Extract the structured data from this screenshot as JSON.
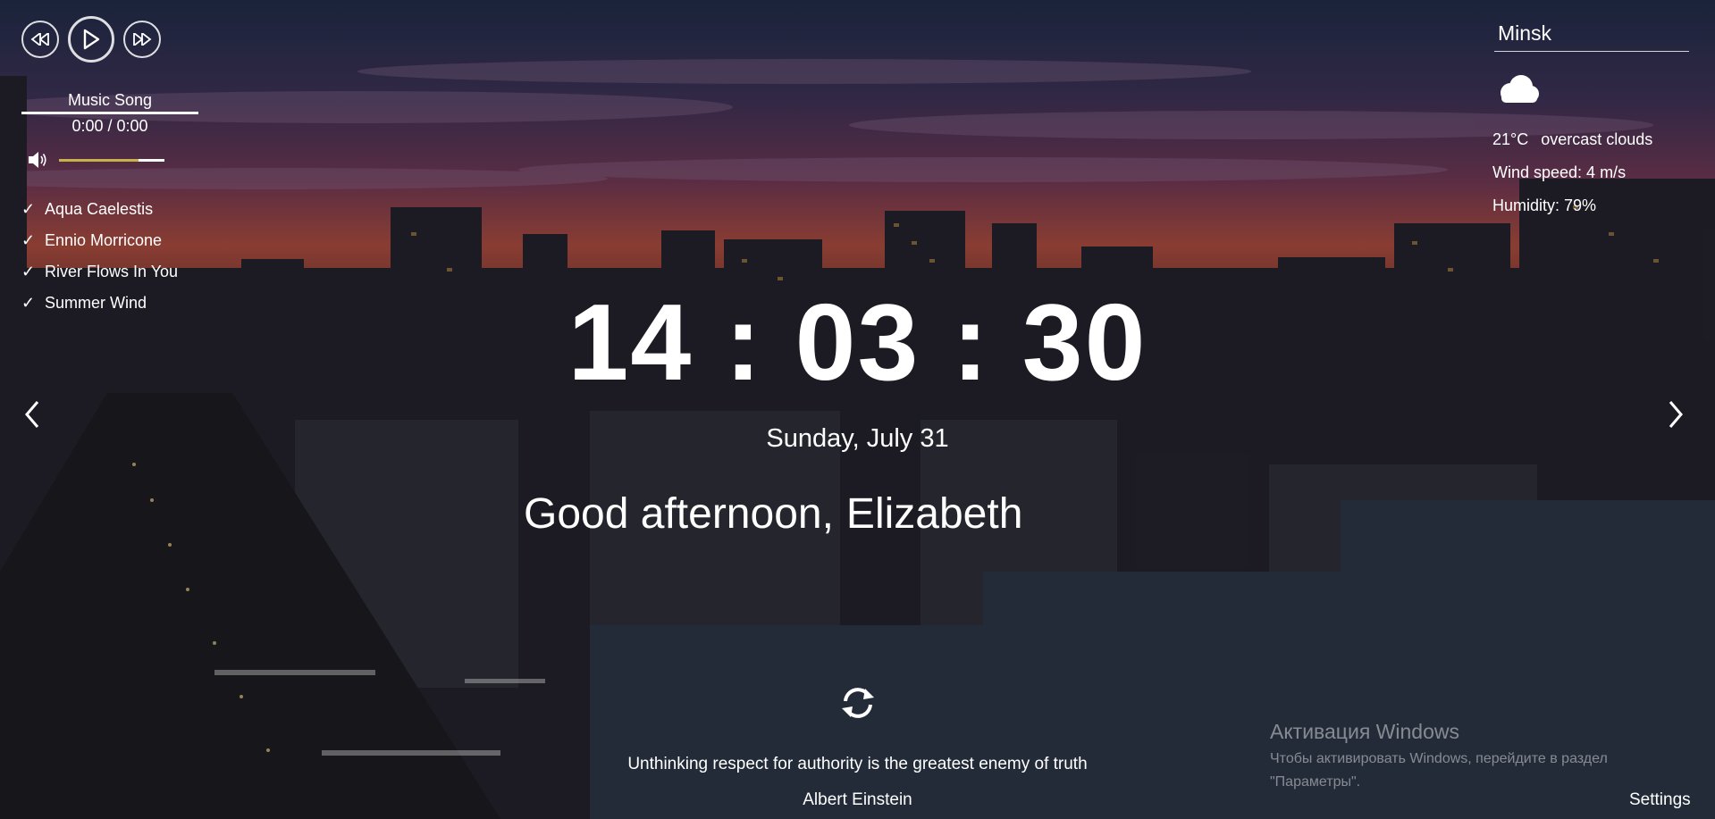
{
  "player": {
    "song_title": "Music Song",
    "time": "0:00 / 0:00",
    "volume_level": 0.75,
    "playlist": [
      {
        "check": "✓",
        "title": "Aqua Caelestis"
      },
      {
        "check": "✓",
        "title": "Ennio Morricone"
      },
      {
        "check": "✓",
        "title": "River Flows In You"
      },
      {
        "check": "✓",
        "title": "Summer Wind"
      }
    ]
  },
  "weather": {
    "city": "Minsk",
    "icon": "cloud-icon",
    "temperature": "21°C",
    "description": "overcast clouds",
    "wind": "Wind speed: 4 m/s",
    "humidity": "Humidity: 79%"
  },
  "clock": {
    "time": "14 : 03 : 30",
    "date": "Sunday, July 31"
  },
  "greeting": {
    "text": "Good afternoon,",
    "name": "Elizabeth"
  },
  "quote": {
    "text": "Unthinking respect for authority is the greatest enemy of truth",
    "author": "Albert Einstein"
  },
  "watermark": {
    "title": "Активация Windows",
    "subtitle": "Чтобы активировать Windows, перейдите в раздел \"Параметры\"."
  },
  "settings_label": "Settings",
  "colors": {
    "volume_accent": "#c9b24a",
    "text": "#ffffff"
  }
}
